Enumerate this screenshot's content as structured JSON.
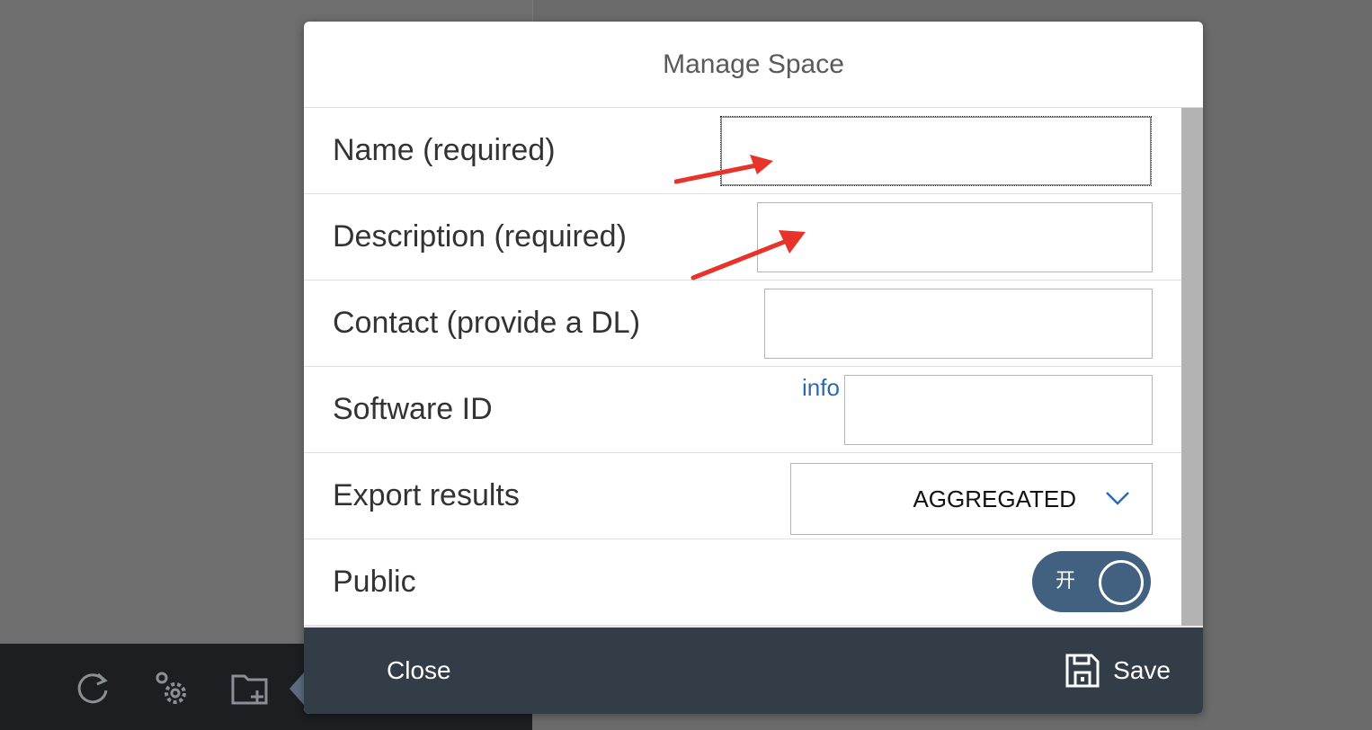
{
  "dialog": {
    "title": "Manage Space"
  },
  "form": {
    "name_label": "Name (required)",
    "name_value": "",
    "description_label": "Description (required)",
    "description_value": "",
    "contact_label": "Contact (provide a DL)",
    "contact_value": "",
    "software_id_label": "Software ID",
    "software_id_info": "info",
    "software_id_value": "",
    "export_label": "Export results",
    "export_value": "AGGREGATED",
    "public_label": "Public",
    "public_toggle_label": "开",
    "public_on": true
  },
  "footer": {
    "close_label": "Close",
    "save_label": "Save"
  },
  "toolbar": {
    "icons": [
      "refresh-icon",
      "settings-gears-icon",
      "new-folder-icon"
    ]
  },
  "colors": {
    "footer_bg": "#333d48",
    "toggle_bg": "#42607f",
    "link": "#2a6bb0",
    "annotation_arrow": "#e8332a"
  }
}
